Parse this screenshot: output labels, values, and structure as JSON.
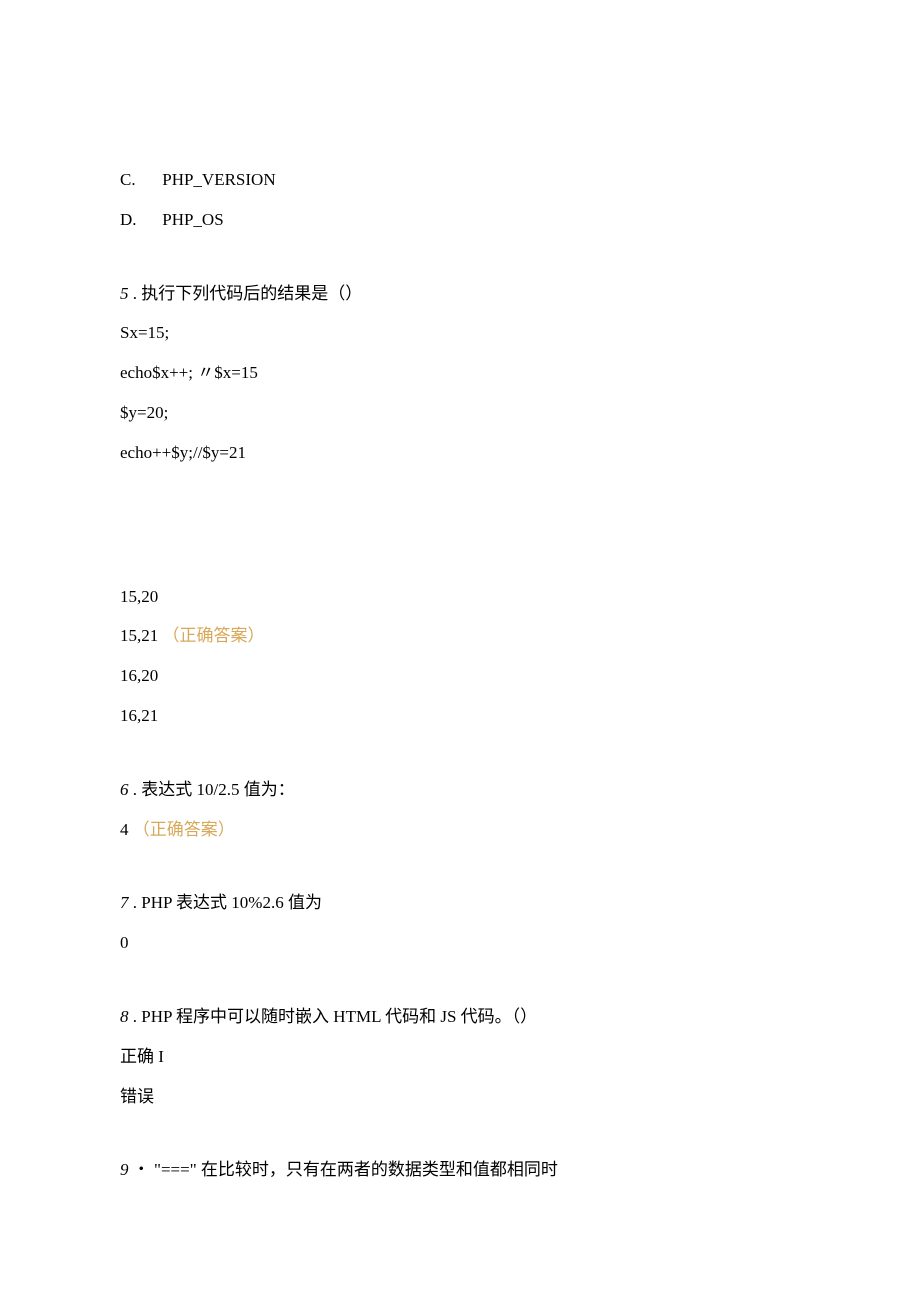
{
  "options_top": [
    {
      "letter": "C.",
      "text": "PHP_VERSION"
    },
    {
      "letter": "D.",
      "text": "PHP_OS"
    }
  ],
  "q5": {
    "num": "5",
    "sep": ".",
    "text": "执行下列代码后的结果是（）",
    "code": [
      "Sx=15;",
      "echo$x++; 〃$x=15",
      "$y=20;",
      "echo++$y;//$y=21"
    ],
    "answers": [
      {
        "text": "15,20",
        "correct": ""
      },
      {
        "text": "15,21",
        "correct": "（正确答案）"
      },
      {
        "text": "16,20",
        "correct": ""
      },
      {
        "text": "16,21",
        "correct": ""
      }
    ]
  },
  "q6": {
    "num": "6",
    "sep": ".",
    "text": "表达式 10/2.5 值为：",
    "answer": "4",
    "correct": "（正确答案）"
  },
  "q7": {
    "num": "7",
    "sep": ".",
    "text": "PHP 表达式 10%2.6 值为",
    "answer": "0"
  },
  "q8": {
    "num": "8",
    "sep": ".",
    "text": "PHP 程序中可以随时嵌入 HTML 代码和 JS 代码。（）",
    "opt1": "正确 I",
    "opt2": "错误"
  },
  "q9": {
    "num": "9",
    "sep": "・",
    "text": "\"===\" 在比较时，只有在两者的数据类型和值都相同时"
  }
}
